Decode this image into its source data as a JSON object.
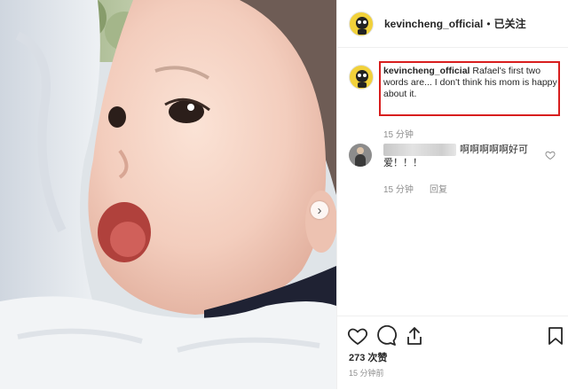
{
  "header": {
    "username": "kevincheng_official",
    "separator": "•",
    "follow_status": "已关注"
  },
  "caption": {
    "username": "kevincheng_official",
    "text": "Rafael's first two words are... I don't think his mom is happy about it.",
    "time": "15 分钟"
  },
  "comment": {
    "username": "jingmengyang",
    "text": "啊啊啊啊啊好可爱！！！",
    "time": "15 分钟",
    "reply_label": "回复"
  },
  "actions": {
    "likes": "273 次赞",
    "posted_time": "15 分钟前"
  },
  "colors": {
    "highlight_border": "#d81e1e",
    "avatar_bg": "#f1d13a"
  },
  "icons": [
    "heart-icon",
    "comment-icon",
    "share-icon",
    "bookmark-icon",
    "chevron-right-icon"
  ]
}
